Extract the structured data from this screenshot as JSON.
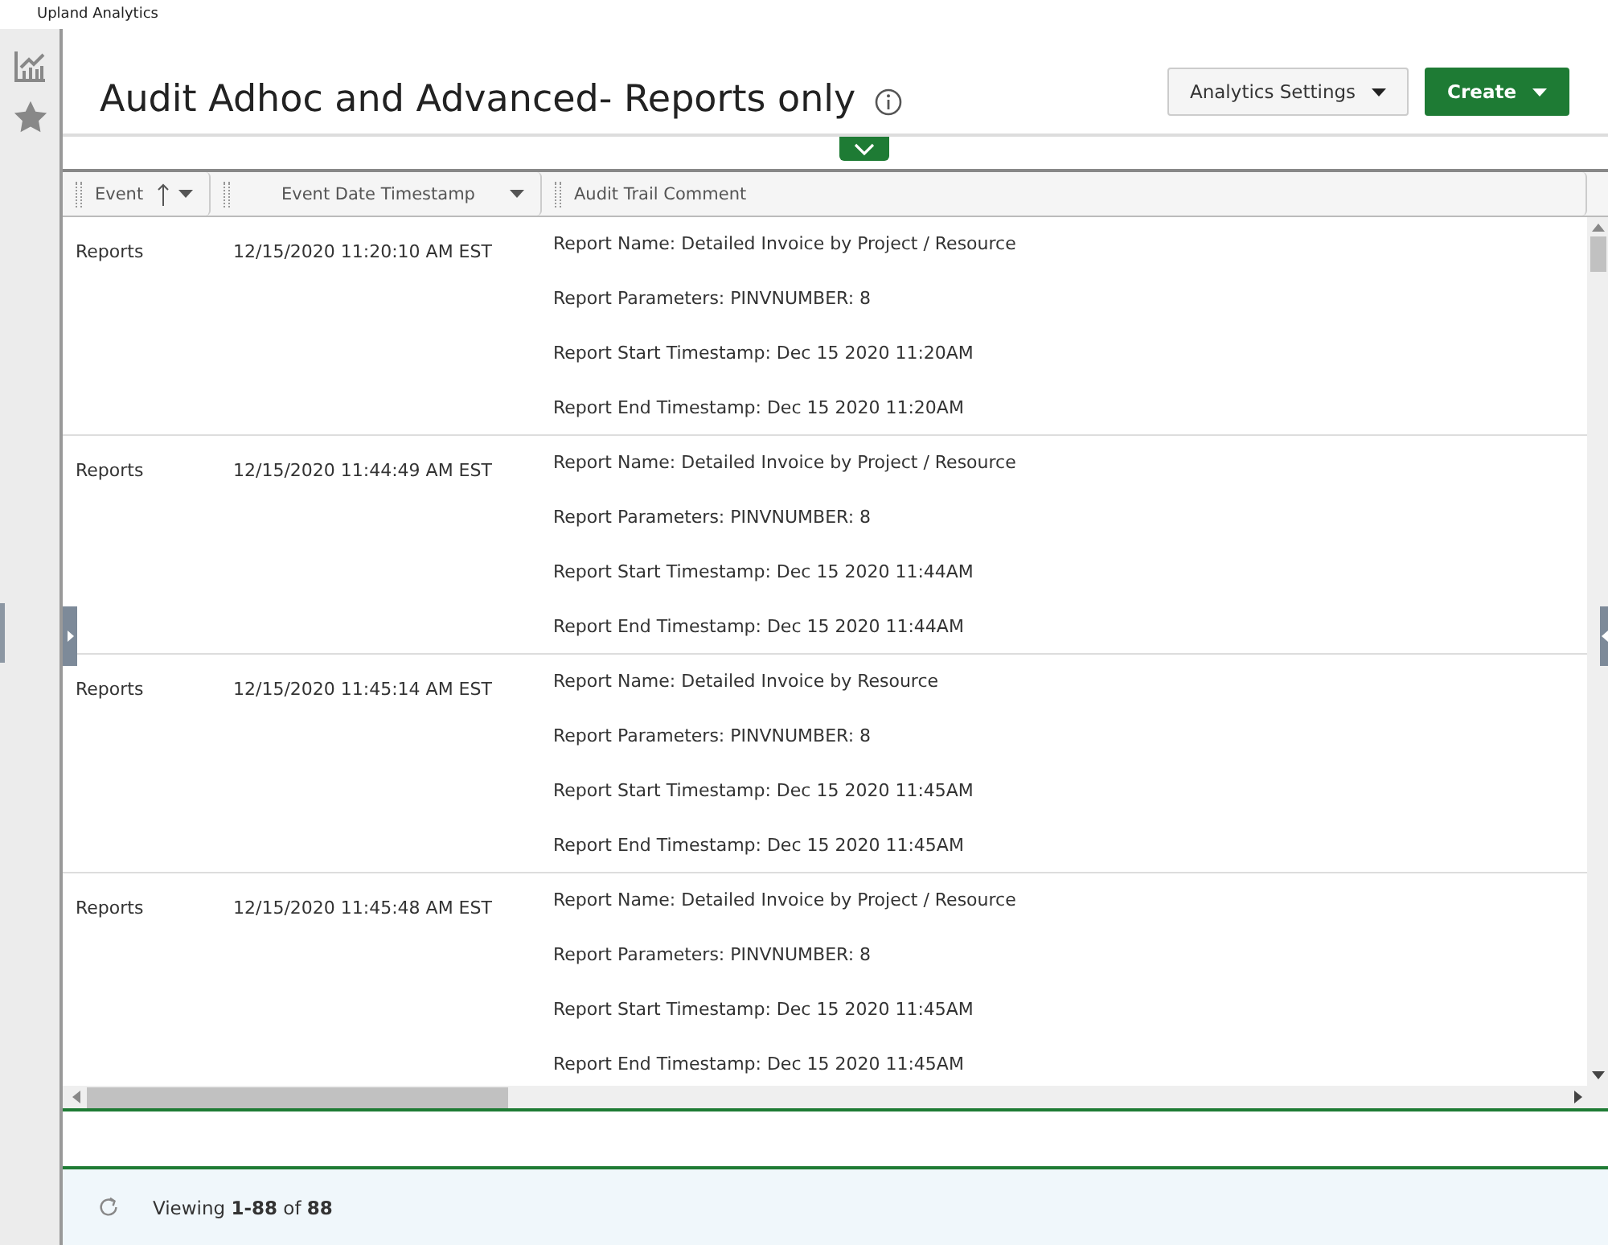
{
  "app_title": "Upland Analytics",
  "sidebar": {
    "items": [
      {
        "kind": "chart"
      },
      {
        "kind": "star"
      }
    ]
  },
  "page": {
    "title": "Audit Adhoc and Advanced- Reports only"
  },
  "buttons": [
    {
      "label": "Analytics Settings",
      "kind": "secondary"
    },
    {
      "label": "Create",
      "kind": "primary"
    }
  ],
  "table": {
    "columns": [
      {
        "label": "Event",
        "sorted": true
      },
      {
        "label": "Event Date Timestamp",
        "sorted": false
      },
      {
        "label": "Audit Trail Comment",
        "sorted": false
      }
    ],
    "rows": [
      {
        "event": "Reports",
        "timestamp": "12/15/2020 11:20:10 AM EST",
        "comment": [
          "Report Name: Detailed Invoice by Project / Resource",
          "Report Parameters: PINVNUMBER:  8",
          "Report Start Timestamp: Dec 15 2020 11:20AM",
          "Report End Timestamp: Dec 15 2020 11:20AM"
        ]
      },
      {
        "event": "Reports",
        "timestamp": "12/15/2020 11:44:49 AM EST",
        "comment": [
          "Report Name: Detailed Invoice by Project / Resource",
          "Report Parameters: PINVNUMBER:  8",
          "Report Start Timestamp: Dec 15 2020 11:44AM",
          "Report End Timestamp: Dec 15 2020 11:44AM"
        ]
      },
      {
        "event": "Reports",
        "timestamp": "12/15/2020 11:45:14 AM EST",
        "comment": [
          "Report Name: Detailed Invoice by Resource",
          "Report Parameters: PINVNUMBER:  8",
          "Report Start Timestamp: Dec 15 2020 11:45AM",
          "Report End Timestamp: Dec 15 2020 11:45AM"
        ]
      },
      {
        "event": "Reports",
        "timestamp": "12/15/2020 11:45:48 AM EST",
        "comment": [
          "Report Name: Detailed Invoice by Project / Resource",
          "Report Parameters: PINVNUMBER:  8",
          "Report Start Timestamp: Dec 15 2020 11:45AM",
          "Report End Timestamp: Dec 15 2020 11:45AM"
        ]
      }
    ]
  },
  "footer": {
    "viewing": "Viewing **1-88** of **88**"
  }
}
